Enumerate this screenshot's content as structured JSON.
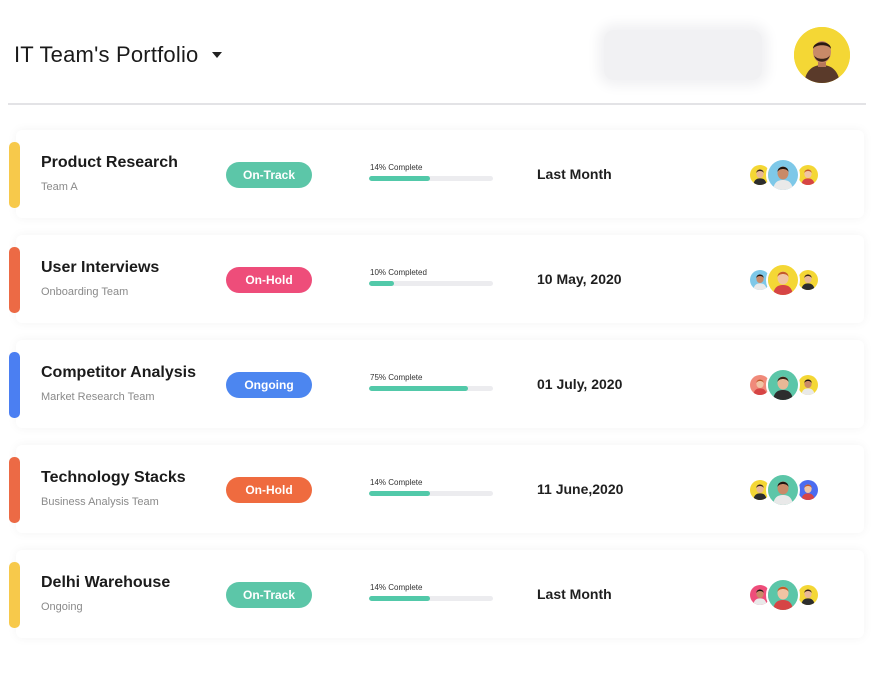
{
  "header": {
    "title": "IT Team's Portfolio",
    "caret_icon": "caret-down-icon",
    "user_avatar_icon": "user-avatar-icon"
  },
  "colors": {
    "on_track": "#5cc6a8",
    "on_hold_pink": "#ee4d7a",
    "ongoing": "#4c86f0",
    "on_hold_orange": "#ef6b3f",
    "accent_yellow": "#f7c94b",
    "accent_orange": "#ec6a45",
    "accent_blue": "#4b7ff2",
    "progress": "#52c9a9"
  },
  "projects": [
    {
      "name": "Product Research",
      "team": "Team A",
      "status": "On-Track",
      "progress_label": "14% Complete",
      "progress": 0.49,
      "date": "Last Month",
      "accent": "#f7c94b",
      "status_color": "#5cc6a8",
      "avatars": [
        "#f4d735",
        "#7ec8e8",
        "#f4d735"
      ]
    },
    {
      "name": "User Interviews",
      "team": "Onboarding Team",
      "status": "On-Hold",
      "progress_label": "10% Completed",
      "progress": 0.2,
      "date": "10 May, 2020",
      "accent": "#ec6a45",
      "status_color": "#ee4d7a",
      "avatars": [
        "#7ec8e8",
        "#f4d735",
        "#f4d735"
      ]
    },
    {
      "name": "Competitor Analysis",
      "team": "Market Research Team",
      "status": "Ongoing",
      "progress_label": "75% Complete",
      "progress": 0.8,
      "date": "01 July, 2020",
      "accent": "#4b7ff2",
      "status_color": "#4c86f0",
      "avatars": [
        "#f08a7a",
        "#5cc6a8",
        "#f4d735"
      ]
    },
    {
      "name": "Technology Stacks",
      "team": "Business Analysis Team",
      "status": "On-Hold",
      "progress_label": "14% Complete",
      "progress": 0.49,
      "date": "11 June,2020",
      "accent": "#ec6a45",
      "status_color": "#ef6b3f",
      "avatars": [
        "#f4d735",
        "#5cc6a8",
        "#4c6cf0"
      ]
    },
    {
      "name": "Delhi Warehouse",
      "team": "Ongoing",
      "status": "On-Track",
      "progress_label": "14% Complete",
      "progress": 0.49,
      "date": "Last Month",
      "accent": "#f7c94b",
      "status_color": "#5cc6a8",
      "avatars": [
        "#ee4d7a",
        "#5cc6a8",
        "#f4d735"
      ]
    }
  ]
}
